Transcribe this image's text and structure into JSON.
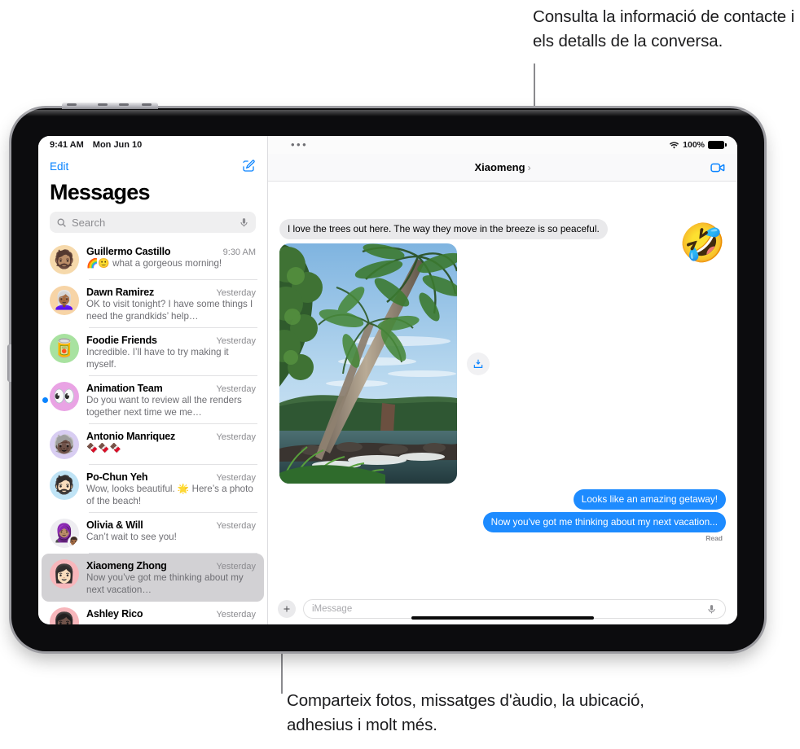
{
  "callouts": {
    "top": "Consulta la informació de contacte i els detalls de la conversa.",
    "bottom": "Comparteix fotos, missatges d'àudio, la ubicació, adhesius i molt més."
  },
  "sidebar": {
    "status_bar": {
      "time": "9:41 AM",
      "date": "Mon Jun 10"
    },
    "edit_label": "Edit",
    "compose_icon": "compose-icon",
    "title": "Messages",
    "search": {
      "placeholder": "Search",
      "icon": "search-icon",
      "dictate_icon": "microphone-icon"
    },
    "conversations": [
      {
        "name": "Guillermo Castillo",
        "time": "9:30 AM",
        "preview": "🌈🙂 what a gorgeous morning!",
        "avatar_emoji": "🧔🏽",
        "avatar_color": "#f6d9ab",
        "unread": false,
        "selected": false
      },
      {
        "name": "Dawn Ramirez",
        "time": "Yesterday",
        "preview": "OK to visit tonight? I have some things I need the grandkids’ help…",
        "avatar_emoji": "👩🏾‍🦳",
        "avatar_color": "#f7d4a6",
        "unread": false,
        "selected": false
      },
      {
        "name": "Foodie Friends",
        "time": "Yesterday",
        "preview": "Incredible. I’ll have to try making it myself.",
        "avatar_emoji": "🥫",
        "avatar_color": "#a8e2a0",
        "unread": false,
        "selected": false
      },
      {
        "name": "Animation Team",
        "time": "Yesterday",
        "preview": "Do you want to review all the renders together next time we me…",
        "avatar_emoji": "👀",
        "avatar_color": "#e9a3e4",
        "unread": true,
        "selected": false
      },
      {
        "name": "Antonio Manriquez",
        "time": "Yesterday",
        "preview": "🍫🍫🍫",
        "avatar_emoji": "🧓🏿",
        "avatar_color": "#d8cdf2",
        "unread": false,
        "selected": false
      },
      {
        "name": "Po-Chun Yeh",
        "time": "Yesterday",
        "preview": "Wow, looks beautiful. 🌟 Here’s a photo of the beach!",
        "avatar_emoji": "🧔🏻",
        "avatar_color": "#bfe3f5",
        "unread": false,
        "selected": false
      },
      {
        "name": "Olivia & Will",
        "time": "Yesterday",
        "preview": "Can’t wait to see you!",
        "avatar_emoji": "🧕🏽",
        "avatar_sub_emoji": "👨🏾",
        "avatar_color": "#eeedf1",
        "unread": false,
        "selected": false
      },
      {
        "name": "Xiaomeng Zhong",
        "time": "Yesterday",
        "preview": "Now you’ve got me thinking about my next vacation…",
        "avatar_emoji": "👩🏻",
        "avatar_color": "#f7b6bb",
        "unread": false,
        "selected": true
      },
      {
        "name": "Ashley Rico",
        "time": "Yesterday",
        "preview": "",
        "avatar_emoji": "👩🏿",
        "avatar_color": "#f7b6bb",
        "unread": false,
        "selected": false
      }
    ]
  },
  "conversation": {
    "status_bar": {
      "dots": "•••",
      "wifi_icon": "wifi-icon",
      "battery_percent": "100%"
    },
    "title": "Xiaomeng",
    "title_chevron": "›",
    "facetime_icon": "facetime-video-icon",
    "sticker_emoji": "🤣",
    "messages": [
      {
        "side": "received",
        "text": "I love the trees out here. The way they move in the breeze is so peaceful."
      },
      {
        "side": "received",
        "type": "photo",
        "alt": "Palm trees leaning over a tropical rocky coastline"
      },
      {
        "side": "sent",
        "text": "Looks like an amazing getaway!"
      },
      {
        "side": "sent",
        "text": "Now you've got me thinking about my next vacation..."
      }
    ],
    "save_icon": "save-to-photos-icon",
    "read_receipt": "Read",
    "composer": {
      "plus_icon": "plus-icon",
      "placeholder": "iMessage",
      "dictate_icon": "microphone-icon"
    }
  },
  "colors": {
    "accent_blue": "#0a84ff",
    "sent_bubble": "#1d8bff",
    "received_bubble": "#e9e9eb",
    "selected_row": "#d2d1d4"
  }
}
